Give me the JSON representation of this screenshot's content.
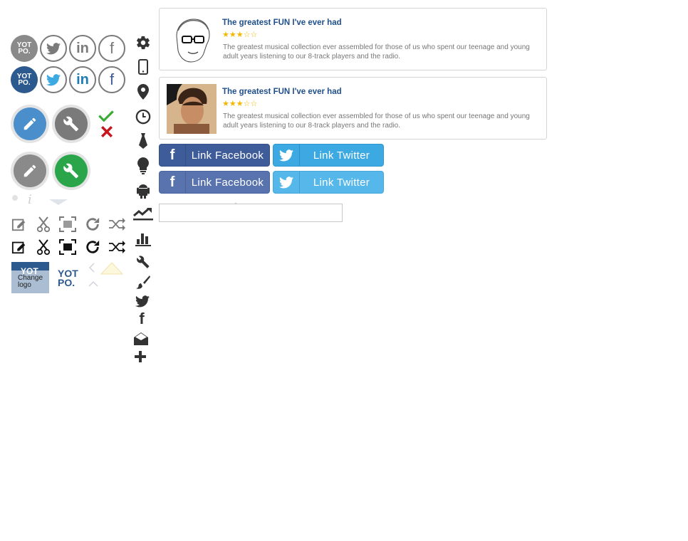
{
  "colors": {
    "facebook": "#3f5c9a",
    "twitter": "#3da9e3",
    "yotpo_blue": "#2d5a8e",
    "star": "#f5b600",
    "title": "#1f4f8a",
    "check": "#3aaa35",
    "cross": "#c8161d",
    "green": "#2aa54a",
    "blue_edit": "#4a8fcb"
  },
  "social_icons": {
    "yotpo_logo_text": [
      "YOT",
      "PO."
    ],
    "twitter_glyph": "twitter-bird",
    "linkedin_glyph": "in",
    "facebook_glyph": "f"
  },
  "yotpo_logo": {
    "change_label_line1": "Change",
    "change_label_line2": "logo",
    "text_line1": "YOT",
    "text_line2": "PO."
  },
  "reviews": [
    {
      "title": "The greatest FUN I've ever had",
      "stars": "★★★☆☆",
      "rating": 3,
      "body": "The greatest musical collection ever assembled for those of us who spent our teenage and young adult years listening to our 8-track players and the radio."
    },
    {
      "title": "The greatest FUN I've ever had",
      "stars": "★★★☆☆",
      "rating": 3,
      "body": "The greatest musical collection ever assembled for those of us who spent our teenage and young adult years listening to our 8-track players and the radio."
    }
  ],
  "buttons": {
    "link_facebook": "Link Facebook",
    "link_twitter": "Link Twitter",
    "facebook_icon": "f"
  },
  "input": {
    "value": "",
    "placeholder": ""
  },
  "icons_column": [
    "gear-icon",
    "mobile-icon",
    "map-pin-icon",
    "clock-icon",
    "tie-icon",
    "lightbulb-icon",
    "android-icon",
    "trend-chart-icon",
    "bar-chart-icon",
    "tools-icon",
    "brush-icon",
    "twitter-icon",
    "facebook-icon",
    "envelope-icon",
    "plus-icon"
  ]
}
